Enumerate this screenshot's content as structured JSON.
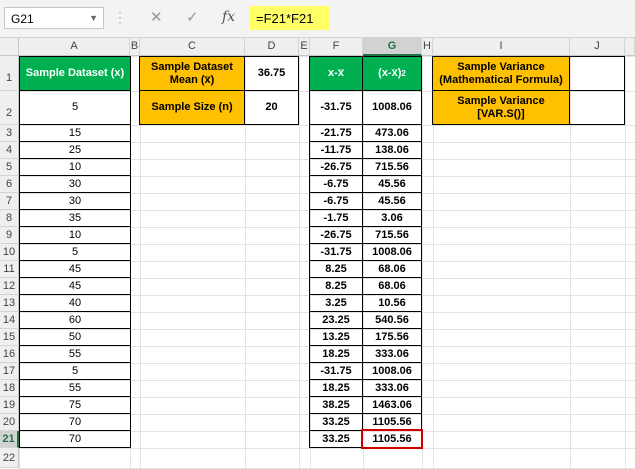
{
  "formula_bar": {
    "name_box": "G21",
    "formula": "=F21*F21",
    "cancel_icon": "cancel-icon",
    "enter_icon": "check-icon",
    "fx_icon": "fx-icon",
    "fx_label": "fx"
  },
  "columns": [
    "A",
    "B",
    "C",
    "D",
    "E",
    "F",
    "G",
    "H",
    "I",
    "J"
  ],
  "rows": [
    "1",
    "2",
    "3",
    "4",
    "5",
    "6",
    "7",
    "8",
    "9",
    "10",
    "11",
    "12",
    "13",
    "14",
    "15",
    "16",
    "17",
    "18",
    "19",
    "20",
    "21",
    "22"
  ],
  "selected_cell": "G21",
  "sheet": {
    "A_header": "Sample Dataset (x)",
    "A_values": [
      "5",
      "15",
      "25",
      "10",
      "30",
      "30",
      "35",
      "10",
      "5",
      "45",
      "45",
      "40",
      "60",
      "50",
      "55",
      "5",
      "55",
      "75",
      "70",
      "70"
    ],
    "C1": "Sample Dataset Mean (x̅)",
    "D1": "36.75",
    "C2": "Sample Size (n)",
    "D2": "20",
    "F_header": "x-x̅",
    "G_header": "(x-x̅)",
    "G_header_sup": "2",
    "F_values": [
      "-31.75",
      "-21.75",
      "-11.75",
      "-26.75",
      "-6.75",
      "-6.75",
      "-1.75",
      "-26.75",
      "-31.75",
      "8.25",
      "8.25",
      "3.25",
      "23.25",
      "13.25",
      "18.25",
      "-31.75",
      "18.25",
      "38.25",
      "33.25",
      "33.25"
    ],
    "G_values": [
      "1008.06",
      "473.06",
      "138.06",
      "715.56",
      "45.56",
      "45.56",
      "3.06",
      "715.56",
      "1008.06",
      "68.06",
      "68.06",
      "10.56",
      "540.56",
      "175.56",
      "333.06",
      "1008.06",
      "333.06",
      "1463.06",
      "1105.56",
      "1105.56"
    ],
    "I1": "Sample Variance (Mathematical Formula)",
    "I2": "Sample Variance [VAR.S()]",
    "J1": "",
    "J2": ""
  }
}
